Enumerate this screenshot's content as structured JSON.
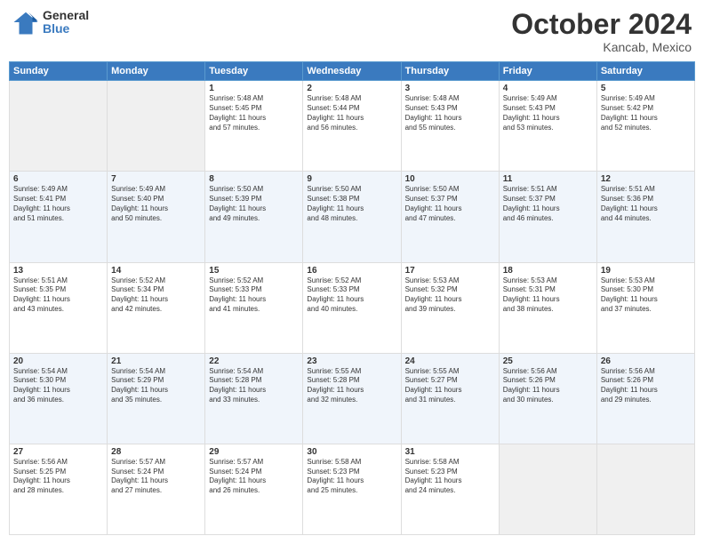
{
  "header": {
    "logo_line1": "General",
    "logo_line2": "Blue",
    "month": "October 2024",
    "location": "Kancab, Mexico"
  },
  "days_of_week": [
    "Sunday",
    "Monday",
    "Tuesday",
    "Wednesday",
    "Thursday",
    "Friday",
    "Saturday"
  ],
  "weeks": [
    [
      {
        "num": "",
        "info": ""
      },
      {
        "num": "",
        "info": ""
      },
      {
        "num": "1",
        "info": "Sunrise: 5:48 AM\nSunset: 5:45 PM\nDaylight: 11 hours\nand 57 minutes."
      },
      {
        "num": "2",
        "info": "Sunrise: 5:48 AM\nSunset: 5:44 PM\nDaylight: 11 hours\nand 56 minutes."
      },
      {
        "num": "3",
        "info": "Sunrise: 5:48 AM\nSunset: 5:43 PM\nDaylight: 11 hours\nand 55 minutes."
      },
      {
        "num": "4",
        "info": "Sunrise: 5:49 AM\nSunset: 5:43 PM\nDaylight: 11 hours\nand 53 minutes."
      },
      {
        "num": "5",
        "info": "Sunrise: 5:49 AM\nSunset: 5:42 PM\nDaylight: 11 hours\nand 52 minutes."
      }
    ],
    [
      {
        "num": "6",
        "info": "Sunrise: 5:49 AM\nSunset: 5:41 PM\nDaylight: 11 hours\nand 51 minutes."
      },
      {
        "num": "7",
        "info": "Sunrise: 5:49 AM\nSunset: 5:40 PM\nDaylight: 11 hours\nand 50 minutes."
      },
      {
        "num": "8",
        "info": "Sunrise: 5:50 AM\nSunset: 5:39 PM\nDaylight: 11 hours\nand 49 minutes."
      },
      {
        "num": "9",
        "info": "Sunrise: 5:50 AM\nSunset: 5:38 PM\nDaylight: 11 hours\nand 48 minutes."
      },
      {
        "num": "10",
        "info": "Sunrise: 5:50 AM\nSunset: 5:37 PM\nDaylight: 11 hours\nand 47 minutes."
      },
      {
        "num": "11",
        "info": "Sunrise: 5:51 AM\nSunset: 5:37 PM\nDaylight: 11 hours\nand 46 minutes."
      },
      {
        "num": "12",
        "info": "Sunrise: 5:51 AM\nSunset: 5:36 PM\nDaylight: 11 hours\nand 44 minutes."
      }
    ],
    [
      {
        "num": "13",
        "info": "Sunrise: 5:51 AM\nSunset: 5:35 PM\nDaylight: 11 hours\nand 43 minutes."
      },
      {
        "num": "14",
        "info": "Sunrise: 5:52 AM\nSunset: 5:34 PM\nDaylight: 11 hours\nand 42 minutes."
      },
      {
        "num": "15",
        "info": "Sunrise: 5:52 AM\nSunset: 5:33 PM\nDaylight: 11 hours\nand 41 minutes."
      },
      {
        "num": "16",
        "info": "Sunrise: 5:52 AM\nSunset: 5:33 PM\nDaylight: 11 hours\nand 40 minutes."
      },
      {
        "num": "17",
        "info": "Sunrise: 5:53 AM\nSunset: 5:32 PM\nDaylight: 11 hours\nand 39 minutes."
      },
      {
        "num": "18",
        "info": "Sunrise: 5:53 AM\nSunset: 5:31 PM\nDaylight: 11 hours\nand 38 minutes."
      },
      {
        "num": "19",
        "info": "Sunrise: 5:53 AM\nSunset: 5:30 PM\nDaylight: 11 hours\nand 37 minutes."
      }
    ],
    [
      {
        "num": "20",
        "info": "Sunrise: 5:54 AM\nSunset: 5:30 PM\nDaylight: 11 hours\nand 36 minutes."
      },
      {
        "num": "21",
        "info": "Sunrise: 5:54 AM\nSunset: 5:29 PM\nDaylight: 11 hours\nand 35 minutes."
      },
      {
        "num": "22",
        "info": "Sunrise: 5:54 AM\nSunset: 5:28 PM\nDaylight: 11 hours\nand 33 minutes."
      },
      {
        "num": "23",
        "info": "Sunrise: 5:55 AM\nSunset: 5:28 PM\nDaylight: 11 hours\nand 32 minutes."
      },
      {
        "num": "24",
        "info": "Sunrise: 5:55 AM\nSunset: 5:27 PM\nDaylight: 11 hours\nand 31 minutes."
      },
      {
        "num": "25",
        "info": "Sunrise: 5:56 AM\nSunset: 5:26 PM\nDaylight: 11 hours\nand 30 minutes."
      },
      {
        "num": "26",
        "info": "Sunrise: 5:56 AM\nSunset: 5:26 PM\nDaylight: 11 hours\nand 29 minutes."
      }
    ],
    [
      {
        "num": "27",
        "info": "Sunrise: 5:56 AM\nSunset: 5:25 PM\nDaylight: 11 hours\nand 28 minutes."
      },
      {
        "num": "28",
        "info": "Sunrise: 5:57 AM\nSunset: 5:24 PM\nDaylight: 11 hours\nand 27 minutes."
      },
      {
        "num": "29",
        "info": "Sunrise: 5:57 AM\nSunset: 5:24 PM\nDaylight: 11 hours\nand 26 minutes."
      },
      {
        "num": "30",
        "info": "Sunrise: 5:58 AM\nSunset: 5:23 PM\nDaylight: 11 hours\nand 25 minutes."
      },
      {
        "num": "31",
        "info": "Sunrise: 5:58 AM\nSunset: 5:23 PM\nDaylight: 11 hours\nand 24 minutes."
      },
      {
        "num": "",
        "info": ""
      },
      {
        "num": "",
        "info": ""
      }
    ]
  ]
}
